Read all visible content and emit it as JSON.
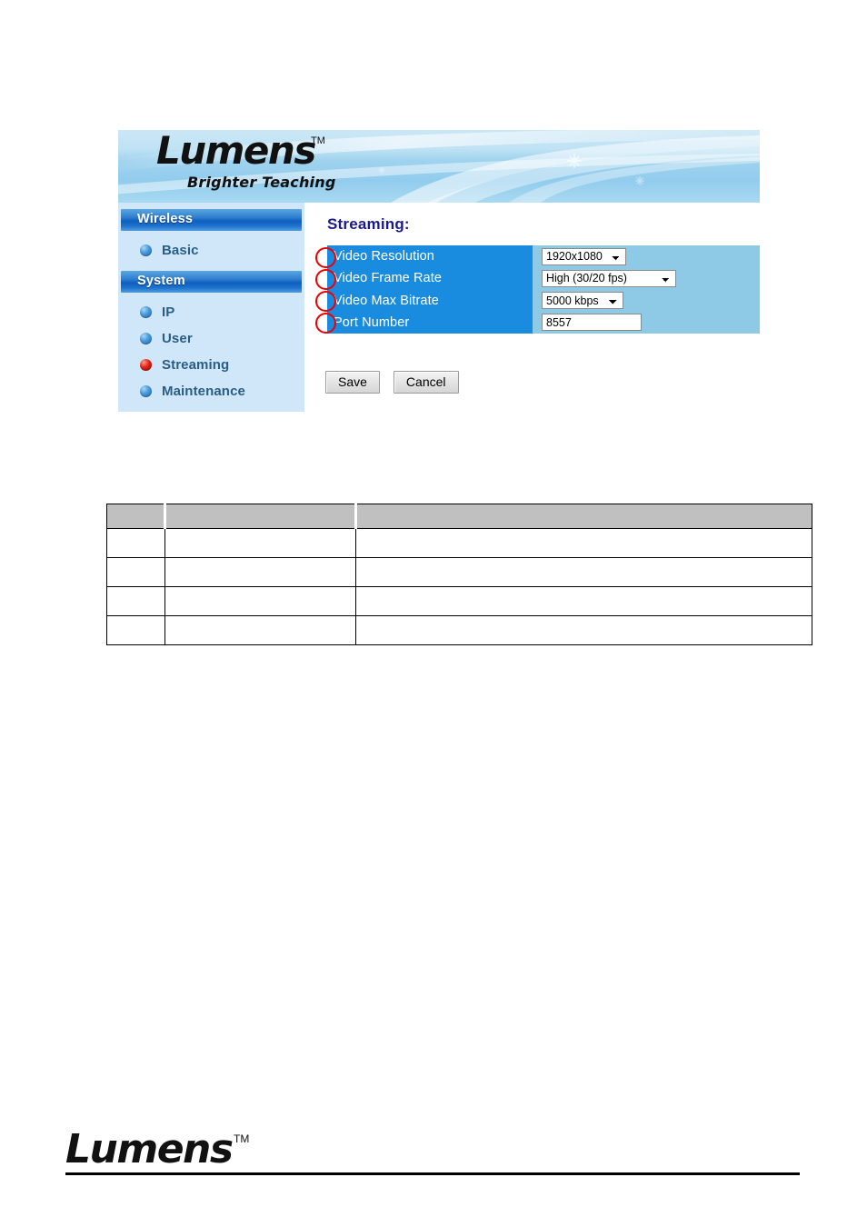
{
  "banner": {
    "logo_text": "Lumens",
    "logo_tm": "TM",
    "tagline": "Brighter Teaching"
  },
  "sidebar": {
    "sections": [
      {
        "header": "Wireless",
        "items": [
          {
            "label": "Basic",
            "bullet": "sphere-bullet-icon",
            "active": false
          }
        ]
      },
      {
        "header": "System",
        "items": [
          {
            "label": "IP",
            "bullet": "sphere-bullet-icon",
            "active": false
          },
          {
            "label": "User",
            "bullet": "sphere-bullet-icon",
            "active": false
          },
          {
            "label": "Streaming",
            "bullet": "sphere-bullet-icon",
            "active": true
          },
          {
            "label": "Maintenance",
            "bullet": "sphere-bullet-icon",
            "active": false
          }
        ]
      }
    ]
  },
  "content": {
    "title": "Streaming:",
    "fields": [
      {
        "label": "Video Resolution",
        "control": "select",
        "value": "1920x1080",
        "options": [
          "1920x1080"
        ]
      },
      {
        "label": "Video Frame Rate",
        "control": "select",
        "value": "High (30/20 fps)",
        "options": [
          "High (30/20 fps)"
        ]
      },
      {
        "label": "Video Max Bitrate",
        "control": "select",
        "value": "5000 kbps",
        "options": [
          "5000 kbps"
        ]
      },
      {
        "label": "Port Number",
        "control": "input",
        "value": "8557",
        "placeholder": ""
      }
    ],
    "buttons": {
      "save": "Save",
      "cancel": "Cancel"
    }
  },
  "annotations": {
    "marker_color": "#ee0000",
    "markers": [
      "circle-marker-1",
      "circle-marker-2",
      "circle-marker-3",
      "circle-marker-4"
    ]
  },
  "table": {
    "headers": [
      "",
      "",
      ""
    ],
    "rows": [
      [
        "",
        "",
        ""
      ],
      [
        "",
        "",
        ""
      ],
      [
        "",
        "",
        ""
      ],
      [
        "",
        "",
        ""
      ]
    ]
  },
  "footer": {
    "logo_text": "Lumens",
    "logo_tm": "TM"
  },
  "colors": {
    "label_panel": "#1a8ce0",
    "field_panel": "#8ecae6",
    "sidebar": "#cfe7f9",
    "title": "#1a1a8c",
    "nav_label": "#2a5d86",
    "active_bullet": "#e02212",
    "table_header": "#c0c0c0"
  }
}
